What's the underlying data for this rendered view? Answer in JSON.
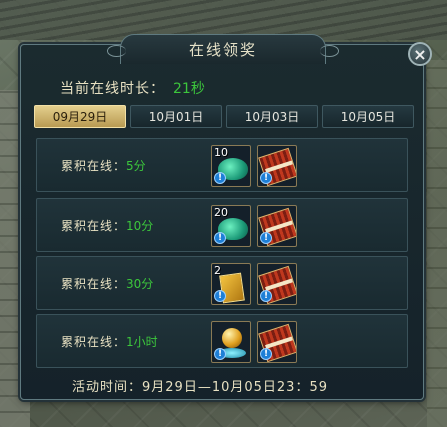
{
  "window": {
    "title": "在线领奖",
    "close_icon": "×"
  },
  "online": {
    "label": "当前在线时长：",
    "value": "21秒"
  },
  "date_tabs": [
    {
      "label": "09月29日",
      "active": true
    },
    {
      "label": "10月01日",
      "active": false
    },
    {
      "label": "10月03日",
      "active": false
    },
    {
      "label": "10月05日",
      "active": false
    }
  ],
  "rewards": [
    {
      "label": "累积在线：",
      "duration": "5分",
      "items": [
        {
          "icon": "jade-gem-icon",
          "count": "10"
        },
        {
          "icon": "firecracker-scroll-icon",
          "count": ""
        }
      ]
    },
    {
      "label": "累积在线：",
      "duration": "10分",
      "items": [
        {
          "icon": "jade-gem-icon",
          "count": "20"
        },
        {
          "icon": "firecracker-scroll-icon",
          "count": ""
        }
      ]
    },
    {
      "label": "累积在线：",
      "duration": "30分",
      "items": [
        {
          "icon": "golden-book-icon",
          "count": "2"
        },
        {
          "icon": "firecracker-scroll-icon",
          "count": ""
        }
      ]
    },
    {
      "label": "累积在线：",
      "duration": "1小时",
      "items": [
        {
          "icon": "golden-orb-icon",
          "count": ""
        },
        {
          "icon": "firecracker-scroll-icon",
          "count": ""
        }
      ]
    }
  ],
  "footer": {
    "text": "活动时间：9月29日—10月05日23：59"
  },
  "colors": {
    "accent_green": "#3cc63c",
    "active_tab": "#d8bf78",
    "label": "#e8e1c2"
  }
}
